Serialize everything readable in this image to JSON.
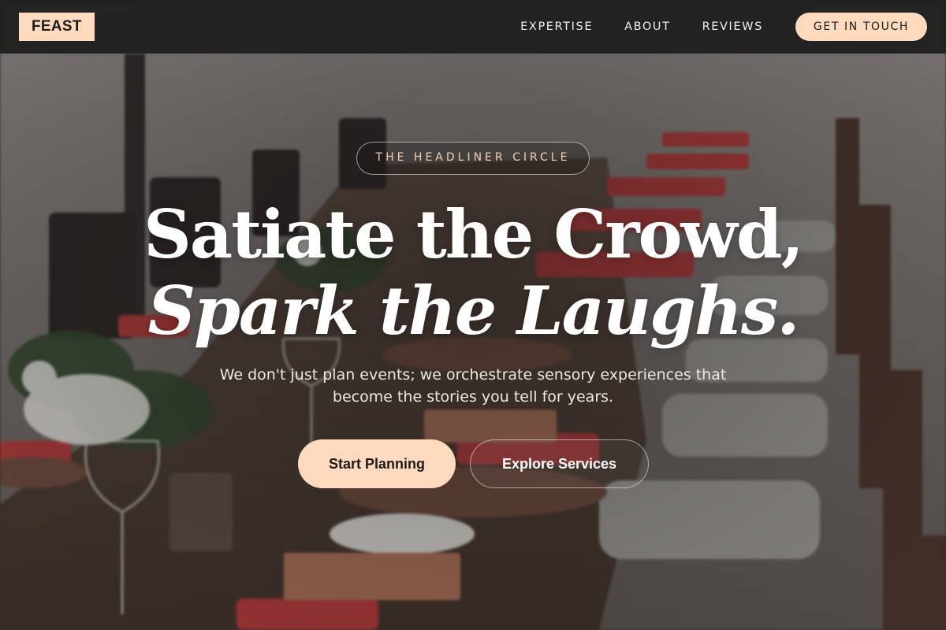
{
  "header": {
    "logo": "FEAST",
    "nav": [
      {
        "label": "EXPERTISE"
      },
      {
        "label": "ABOUT"
      },
      {
        "label": "REVIEWS"
      }
    ],
    "cta_label": "GET IN TOUCH"
  },
  "hero": {
    "eyebrow": "THE HEADLINER CIRCLE",
    "headline_line1": "Satiate the Crowd,",
    "headline_line2": "Spark the Laughs.",
    "subtitle": "We don't just plan events; we orchestrate sensory experiences that become the stories you tell for years.",
    "primary_button": "Start Planning",
    "secondary_button": "Explore Services",
    "background_image": "outdoor-dining-table-photo"
  },
  "colors": {
    "accent": "#fdd9bd",
    "header_bg": "#1e1e1e",
    "text_light": "#ffffff"
  }
}
